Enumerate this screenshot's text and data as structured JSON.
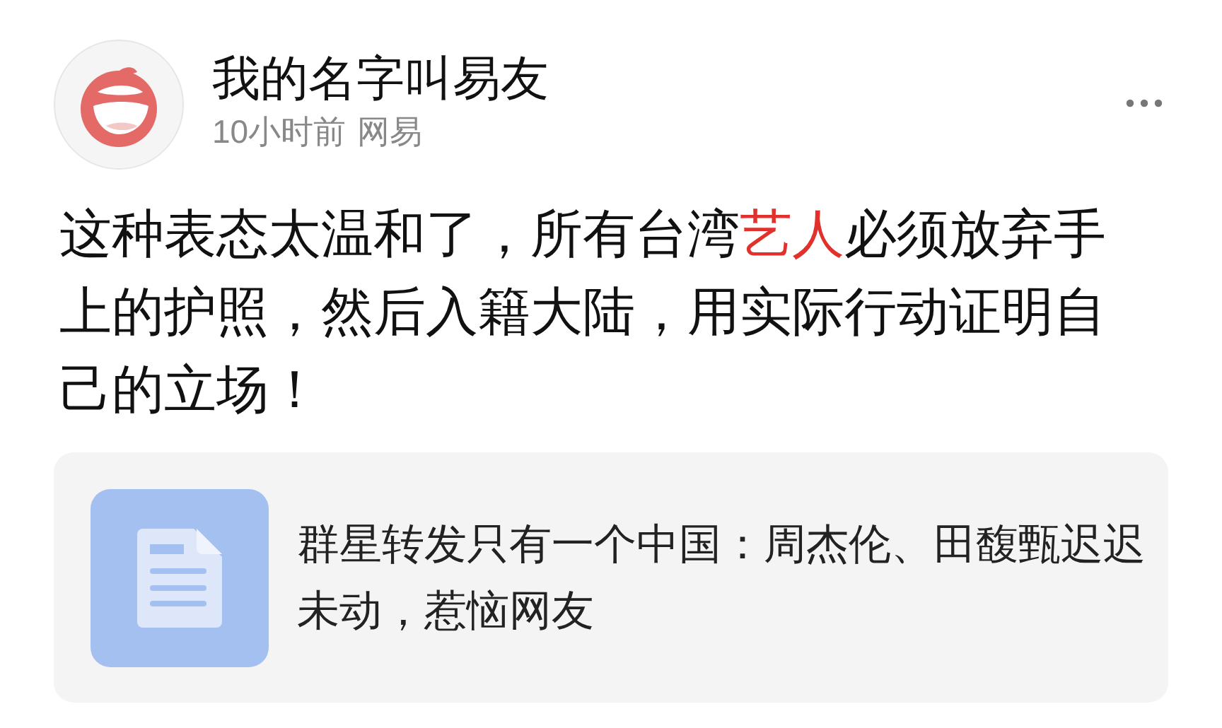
{
  "post": {
    "author": "我的名字叫易友",
    "time": "10小时前",
    "source": "网易",
    "body": [
      {
        "kind": "text",
        "text": "这种表态太温和了，所有台湾"
      },
      {
        "kind": "highlight",
        "text": "艺人"
      },
      {
        "kind": "text",
        "text": "必须放弃手上的护照，然后入籍大陆，用实际行动证明自己的立场！"
      }
    ],
    "link_card": {
      "title": "群星转发只有一个中国：周杰伦、田馥甄迟迟未动，惹恼网友"
    }
  }
}
